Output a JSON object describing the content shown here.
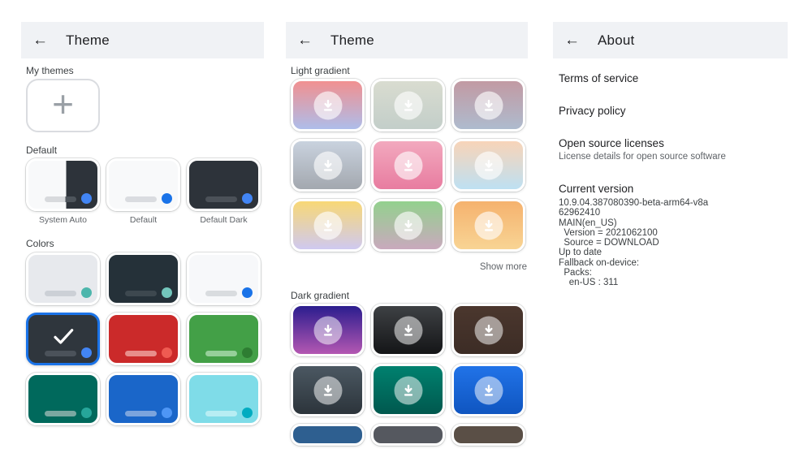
{
  "icons": {
    "back": "←",
    "plus": "+",
    "check": "check-mark",
    "download": "download-arrow"
  },
  "ui_colors": {
    "accent_blue": "#1a73e8",
    "header_bg": "#f0f2f5",
    "title_text": "#202124",
    "muted_text": "#5f6368"
  },
  "theme_screen": {
    "title": "Theme",
    "my_themes_label": "My themes",
    "default_label": "Default",
    "colors_label": "Colors",
    "default_themes": [
      {
        "name": "System Auto",
        "split": {
          "left": "#f8f9fa",
          "right": "#2d333a"
        },
        "bar_left": "#d8dadd",
        "bar_right": "#4d545b",
        "dot": "#4285f4"
      },
      {
        "name": "Default",
        "bg": "#f8f9fa",
        "bar": "#dadce0",
        "dot": "#1a73e8"
      },
      {
        "name": "Default Dark",
        "bg": "#2d333a",
        "bar": "#4b5158",
        "dot": "#4285f4"
      }
    ],
    "color_swatches": [
      {
        "bg": "#e7e9ed",
        "bar": "#ccd0d6",
        "dot": "#4db6ac"
      },
      {
        "bg": "#253139",
        "bar": "#3d484f",
        "dot": "#73c6bc"
      },
      {
        "bg": "#f7f8fa",
        "bar": "#d9dcdf",
        "dot": "#1a73e8"
      },
      {
        "bg": "#2f363d",
        "bar": "#4b525a",
        "dot": "#4285f4",
        "selected": true
      },
      {
        "bg": "#cb2a2a",
        "bar": "#e88e8a",
        "dot": "#ef5b52"
      },
      {
        "bg": "#43a047",
        "bar": "#96cf9a",
        "dot": "#2e7d32"
      },
      {
        "bg": "#00695c",
        "bar": "#7aa8a1",
        "dot": "#26a69a"
      },
      {
        "bg": "#1a66c9",
        "bar": "#7ba4dd",
        "dot": "#4e96f5"
      },
      {
        "bg": "#7fdce8",
        "bar": "#b7edf3",
        "dot": "#00acc1"
      }
    ]
  },
  "gradient_screen": {
    "title": "Theme",
    "light_label": "Light gradient",
    "dark_label": "Dark gradient",
    "show_more_label": "Show more",
    "light_gradients": [
      {
        "from": "#f19090",
        "to": "#aebdea"
      },
      {
        "from": "#d9dcd0",
        "to": "#c3cec9"
      },
      {
        "from": "#c29aa3",
        "to": "#aebbce"
      },
      {
        "from": "#c9d2de",
        "to": "#a3a8af"
      },
      {
        "from": "#f2a9be",
        "to": "#e87ca0"
      },
      {
        "from": "#f8d4b8",
        "to": "#bee0f2"
      },
      {
        "from": "#f8d876",
        "to": "#cfc9f0"
      },
      {
        "from": "#93d18e",
        "to": "#c9a9bd"
      },
      {
        "from": "#f5b26e",
        "to": "#f8d494"
      }
    ],
    "dark_gradients": [
      {
        "from": "#2b1d8e",
        "to": "#b457b2"
      },
      {
        "from": "#3e4144",
        "to": "#141517"
      },
      {
        "from": "#4b372e",
        "to": "#3c2c25"
      },
      {
        "from": "#4b5862",
        "to": "#2c343b"
      },
      {
        "from": "#00816f",
        "to": "#00584e"
      },
      {
        "from": "#2173e8",
        "to": "#0f55c0"
      },
      {
        "from": "#2e5f90",
        "to": "#2e5f90"
      },
      {
        "from": "#55585f",
        "to": "#55585f"
      },
      {
        "from": "#5a4f46",
        "to": "#5a4f46"
      }
    ]
  },
  "about_screen": {
    "title": "About",
    "items": [
      {
        "title": "Terms of service"
      },
      {
        "title": "Privacy policy"
      },
      {
        "title": "Open source licenses",
        "subtitle": "License details for open source software"
      }
    ],
    "current_version": {
      "title": "Current version",
      "lines": [
        "10.9.04.387080390-beta-arm64-v8a",
        "62962410",
        "MAIN(en_US)",
        "  Version = 2021062100",
        "  Source = DOWNLOAD",
        "Up to date",
        "Fallback on-device:",
        "  Packs:",
        "    en-US : 311"
      ]
    }
  }
}
